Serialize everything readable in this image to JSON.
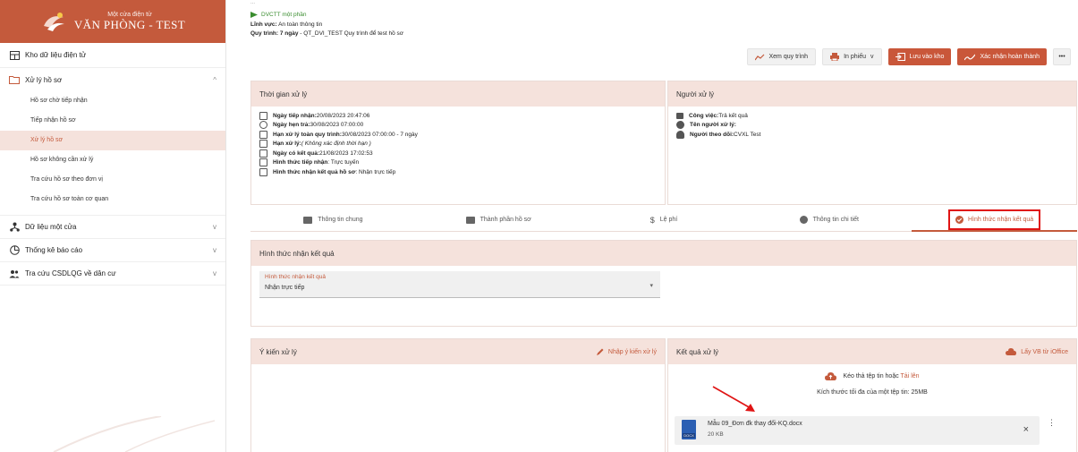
{
  "sidebar": {
    "logo_sub": "Một cửa điện tử",
    "logo_main": "VĂN PHÒNG - TEST",
    "kho": "Kho dữ liệu điện tử",
    "xuly": {
      "label": "Xử lý hồ sơ",
      "items": [
        {
          "label": "Hồ sơ chờ tiếp nhận"
        },
        {
          "label": "Tiếp nhận hồ sơ"
        },
        {
          "label": "Xử lý hồ sơ"
        },
        {
          "label": "Hồ sơ không cần xử lý"
        },
        {
          "label": "Tra cứu hồ sơ theo đơn vị"
        },
        {
          "label": "Tra cứu hồ sơ toàn cơ quan"
        }
      ]
    },
    "groups": [
      {
        "label": "Dữ liệu một cửa"
      },
      {
        "label": "Thống kê báo cáo"
      },
      {
        "label": "Tra cứu CSDLQG về dân cư"
      }
    ]
  },
  "header": {
    "dvctt": "DVCTT một phần",
    "linhvuc_label": "Lĩnh vực:",
    "linhvuc_value": "An toàn thông tin",
    "quytrinh_label": "Quy trình: 7 ngày",
    "quytrinh_value": " - QT_DVI_TEST Quy trình để test hồ sơ"
  },
  "actions": {
    "xem_quy_trinh": "Xem quy trình",
    "in_phieu": "In phiếu",
    "luu_vao_kho": "Lưu vào kho",
    "xac_nhan": "Xác nhận hoàn thành"
  },
  "thoigian": {
    "title": "Thời gian xử lý",
    "lines": [
      {
        "label": "Ngày tiếp nhận:",
        "value": " 20/08/2023 20:47:06"
      },
      {
        "label": "Ngày hẹn trả:",
        "value": " 30/08/2023 07:00:00"
      },
      {
        "label": "Hạn xử lý toàn quy trình:",
        "value": " 30/08/2023 07:00:00 - 7 ngày"
      },
      {
        "label": "Hạn xử lý:",
        "value": " ( Không xác định thời hạn )"
      },
      {
        "label": "Ngày có kết quả:",
        "value": " 21/08/2023 17:02:53"
      },
      {
        "label": "Hình thức tiếp nhận",
        "value": " : Trực tuyến"
      },
      {
        "label": "Hình thức nhận kết quả hồ sơ",
        "value": " : Nhận trực tiếp"
      }
    ]
  },
  "nguoixuly": {
    "title": "Người xử lý",
    "lines": [
      {
        "label": "Công việc:",
        "value": " Trả kết quả"
      },
      {
        "label": "Tên người xử lý:",
        "value": ""
      },
      {
        "label": "Người theo dõi:",
        "value": " CVXL Test"
      }
    ]
  },
  "tabs": [
    {
      "label": "Thông tin chung"
    },
    {
      "label": "Thành phần hồ sơ"
    },
    {
      "label": "Lệ phí"
    },
    {
      "label": "Thông tin chi tiết"
    },
    {
      "label": "Hình thức nhận kết quả"
    }
  ],
  "hinhthuc": {
    "title": "Hình thức nhận kết quả",
    "field_label": "Hình thức nhận kết quả",
    "field_value": "Nhận trực tiếp"
  },
  "ykien": {
    "title": "Ý kiến xử lý",
    "action": "Nhập ý kiến xử lý"
  },
  "ketqua": {
    "title": "Kết quả xử lý",
    "action": "Lấy VB từ iOffice",
    "drop_text": "Kéo thả tệp tin hoặc ",
    "upload_link": "Tải lên",
    "max_size": "Kích thước tối đa của một tệp tin: 25MB",
    "file_name": "Mẫu 09_Đơn đk thay đổi-KQ.docx",
    "file_size": "20 KB",
    "file_ext": "DOCX"
  },
  "colors": {
    "accent": "#c45a3c",
    "highlight_box": "#e01414"
  }
}
